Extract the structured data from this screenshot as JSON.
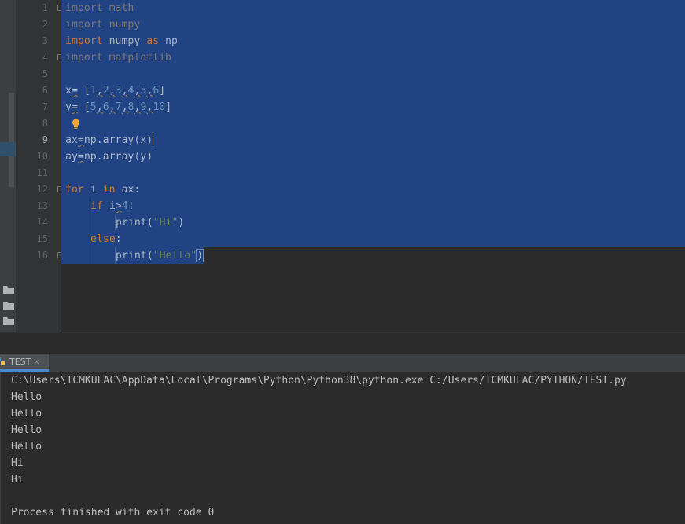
{
  "editor": {
    "line_numbers": [
      "1",
      "2",
      "3",
      "4",
      "5",
      "6",
      "7",
      "8",
      "9",
      "10",
      "11",
      "12",
      "13",
      "14",
      "15",
      "16"
    ],
    "current_line": "9",
    "lines": {
      "l1": {
        "kw": "import",
        "rest": " math"
      },
      "l2": {
        "kw": "import",
        "rest": " numpy"
      },
      "l3": {
        "kw": "import",
        "mod": " numpy ",
        "kw2": "as",
        "rest": " np"
      },
      "l4": {
        "kw": "import",
        "rest": " matplotlib"
      },
      "l6": {
        "name": "x",
        "eq": "=",
        "open": " [",
        "n1": "1",
        "n2": "2",
        "n3": "3",
        "n4": "4",
        "n5": "5",
        "n6": "6",
        "close": "]",
        "comma": ","
      },
      "l7": {
        "name": "y",
        "eq": "=",
        "open": " [",
        "n1": "5",
        "n2": "6",
        "n3": "7",
        "n4": "8",
        "n5": "9",
        "n6": "10",
        "close": "]",
        "comma": ","
      },
      "l9": {
        "lhs": "ax",
        "eq": "=",
        "rhs": "np.array(x)"
      },
      "l10": {
        "lhs": "ay",
        "eq": "=",
        "rhs": "np.array(y)"
      },
      "l12": {
        "kw": "for",
        "mid": " i ",
        "kw2": "in",
        "rest": " ax:"
      },
      "l13": {
        "kw": "if",
        "var": " i",
        "op": ">",
        "num": "4",
        "colon": ":"
      },
      "l14": {
        "fn": "print(",
        "str": "\"Hi\"",
        "close": ")"
      },
      "l15": {
        "kw": "else",
        "colon": ":"
      },
      "l16": {
        "fn": "print(",
        "str": "\"Hello\"",
        "close": ")"
      }
    }
  },
  "run_panel": {
    "tab_label": "TEST",
    "tab_close": "×",
    "tab_icon": "python-icon"
  },
  "console": {
    "lines": [
      "C:\\Users\\TCMKULAC\\AppData\\Local\\Programs\\Python\\Python38\\python.exe C:/Users/TCMKULAC/PYTHON/TEST.py",
      "Hello",
      "Hello",
      "Hello",
      "Hello",
      "Hi",
      "Hi",
      "",
      "Process finished with exit code 0"
    ]
  },
  "colors": {
    "background": "#2b2b2b",
    "selection": "#214283",
    "keyword": "#cc7832",
    "number": "#6897bb",
    "string": "#6a8759",
    "text": "#a9b7c6"
  }
}
